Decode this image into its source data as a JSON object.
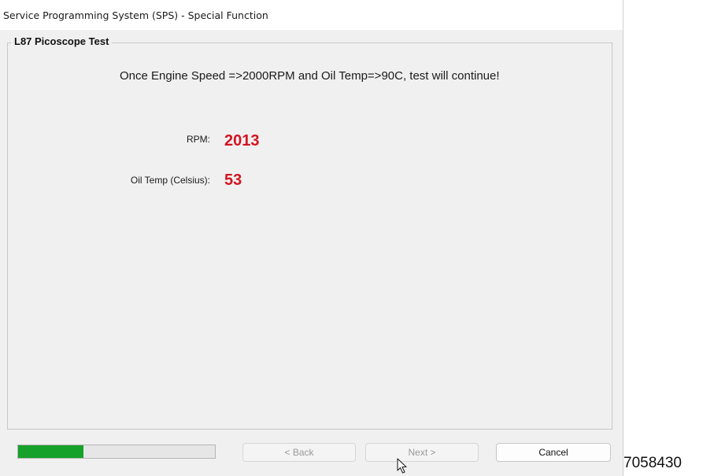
{
  "window": {
    "title": "Service Programming System (SPS) - Special Function"
  },
  "group": {
    "title": "L87 Picoscope Test"
  },
  "instruction": "Once Engine Speed =>2000RPM and Oil Temp=>90C, test will continue!",
  "readings": {
    "rpm": {
      "label": "RPM:",
      "value": "2013"
    },
    "oil_temp": {
      "label": "Oil Temp (Celsius):",
      "value": "53"
    }
  },
  "progress": {
    "fraction": 0.33,
    "color": "#15a12a"
  },
  "buttons": {
    "back": {
      "label": "< Back",
      "enabled": false
    },
    "next": {
      "label": "Next >",
      "enabled": false
    },
    "cancel": {
      "label": "Cancel",
      "enabled": true
    }
  },
  "side_number": "7058430",
  "colors": {
    "value_red": "#d11521"
  }
}
